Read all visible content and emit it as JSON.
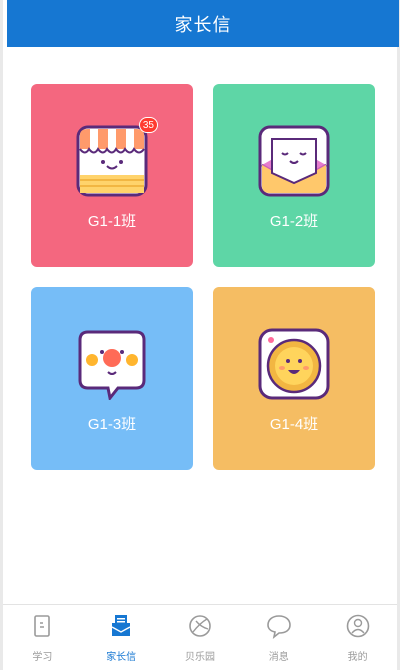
{
  "header": {
    "title": "家长信"
  },
  "classes": [
    {
      "label": "G1-1班",
      "icon": "shop-awning-face-icon",
      "badge": "35",
      "color": "#f4677f"
    },
    {
      "label": "G1-2班",
      "icon": "envelope-face-icon",
      "color": "#5ed6a6"
    },
    {
      "label": "G1-3班",
      "icon": "speech-bubble-face-icon",
      "color": "#76bdf7"
    },
    {
      "label": "G1-4班",
      "icon": "smiley-coin-icon",
      "color": "#f5bd63"
    }
  ],
  "tabbar": {
    "active_index": 1,
    "items": [
      {
        "label": "学习",
        "icon": "study-book-icon"
      },
      {
        "label": "家长信",
        "icon": "parent-letter-icon"
      },
      {
        "label": "贝乐园",
        "icon": "paradise-ball-icon"
      },
      {
        "label": "消息",
        "icon": "message-bubble-icon"
      },
      {
        "label": "我的",
        "icon": "profile-person-icon"
      }
    ]
  },
  "colors": {
    "header": "#1677d2",
    "tab_active": "#1677d2",
    "tab_inactive": "#9a9a9a"
  }
}
